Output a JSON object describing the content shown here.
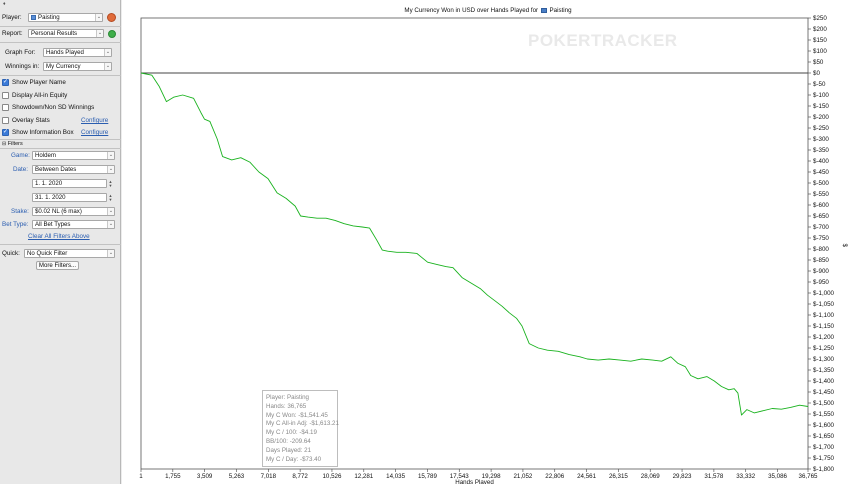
{
  "sidebar": {
    "top_mark": "♦",
    "player_label": "Player:",
    "player_value": "Paisting",
    "report_label": "Report:",
    "report_value": "Personal Results",
    "graph_for_label": "Graph For:",
    "graph_for_value": "Hands Played",
    "winnings_in_label": "Winnings in:",
    "winnings_in_value": "My Currency",
    "options": [
      {
        "label": "Show Player Name",
        "checked": true
      },
      {
        "label": "Display All-in Equity",
        "checked": false
      },
      {
        "label": "Showdown/Non SD Winnings",
        "checked": false
      },
      {
        "label": "Overlay Stats",
        "checked": false,
        "link": "Configure"
      },
      {
        "label": "Show Information Box",
        "checked": true,
        "link": "Configure"
      }
    ],
    "filters_header": "Filters",
    "game_label": "Game:",
    "game_value": "Holdem",
    "date_label": "Date:",
    "date_value": "Between Dates",
    "date_from": "1.  1. 2020",
    "date_to": "31.  1. 2020",
    "stake_label": "Stake:",
    "stake_value": "$0.02 NL (6 max)",
    "bet_type_label": "Bet Type:",
    "bet_type_value": "All Bet Types",
    "clear_filters": "Clear All Filters Above",
    "quick_label": "Quick:",
    "quick_value": "No Quick Filter",
    "more_filters": "More Filters..."
  },
  "chart_data": {
    "type": "line",
    "title": "My Currency Won in USD over Hands Played for",
    "title_player": "Paisting",
    "watermark": "POKERTRACKER",
    "xlabel": "Hands Played",
    "ylabel": "$",
    "xlim": [
      1,
      36765
    ],
    "ylim": [
      -1800,
      250
    ],
    "x_ticks": [
      1,
      1755,
      3509,
      5263,
      7018,
      8772,
      10526,
      12281,
      14035,
      15789,
      17543,
      19298,
      21052,
      22806,
      24561,
      26315,
      28069,
      29823,
      31578,
      33332,
      35086,
      36765
    ],
    "x_tick_labels": [
      "1",
      "1,755",
      "3,509",
      "5,263",
      "7,018",
      "8,772",
      "10,526",
      "12,281",
      "14,035",
      "15,789",
      "17,543",
      "19,298",
      "21,052",
      "22,806",
      "24,561",
      "26,315",
      "28,069",
      "29,823",
      "31,578",
      "33,332",
      "35,086",
      "36,765"
    ],
    "y_ticks": [
      250,
      200,
      150,
      100,
      50,
      0,
      -50,
      -100,
      -150,
      -200,
      -250,
      -300,
      -350,
      -400,
      -450,
      -500,
      -550,
      -600,
      -650,
      -700,
      -750,
      -800,
      -850,
      -900,
      -950,
      -1000,
      -1050,
      -1100,
      -1150,
      -1200,
      -1250,
      -1300,
      -1350,
      -1400,
      -1450,
      -1500,
      -1550,
      -1600,
      -1650,
      -1700,
      -1750,
      -1800
    ],
    "y_tick_labels": [
      "$250",
      "$200",
      "$150",
      "$100",
      "$50",
      "$0",
      "$-50",
      "$-100",
      "$-150",
      "$-200",
      "$-250",
      "$-300",
      "$-350",
      "$-400",
      "$-450",
      "$-500",
      "$-550",
      "$-600",
      "$-650",
      "$-700",
      "$-750",
      "$-800",
      "$-850",
      "$-900",
      "$-950",
      "$-1,000",
      "$-1,050",
      "$-1,100",
      "$-1,150",
      "$-1,200",
      "$-1,250",
      "$-1,300",
      "$-1,350",
      "$-1,400",
      "$-1,450",
      "$-1,500",
      "$-1,550",
      "$-1,600",
      "$-1,650",
      "$-1,700",
      "$-1,750",
      "$-1,800"
    ],
    "series": [
      {
        "color": "#19b21e",
        "x": [
          1,
          600,
          1000,
          1400,
          1800,
          2300,
          2900,
          3300,
          3500,
          3800,
          4200,
          4500,
          5000,
          5500,
          6000,
          6500,
          7000,
          7500,
          8000,
          8500,
          8800,
          9200,
          9700,
          10200,
          10700,
          11200,
          11700,
          12200,
          12600,
          13000,
          13300,
          13600,
          14100,
          14600,
          15200,
          15800,
          16300,
          16800,
          17200,
          17700,
          18200,
          18700,
          19100,
          19500,
          19900,
          20300,
          20700,
          21000,
          21400,
          21900,
          22400,
          23000,
          23600,
          24200,
          24600,
          25200,
          25800,
          26400,
          27000,
          27600,
          28200,
          28700,
          29200,
          29600,
          30000,
          30300,
          30700,
          31200,
          31600,
          32000,
          32400,
          32700,
          32900,
          33100,
          33400,
          33800,
          34300,
          34800,
          35300,
          35800,
          36300,
          36765
        ],
        "y": [
          0,
          -10,
          -60,
          -130,
          -110,
          -100,
          -115,
          -180,
          -210,
          -220,
          -300,
          -380,
          -395,
          -385,
          -405,
          -450,
          -480,
          -545,
          -570,
          -605,
          -650,
          -655,
          -660,
          -660,
          -670,
          -685,
          -695,
          -700,
          -705,
          -760,
          -805,
          -810,
          -815,
          -815,
          -820,
          -860,
          -870,
          -880,
          -885,
          -930,
          -955,
          -980,
          -1010,
          -1035,
          -1060,
          -1090,
          -1115,
          -1150,
          -1230,
          -1250,
          -1260,
          -1265,
          -1280,
          -1290,
          -1300,
          -1305,
          -1300,
          -1305,
          -1310,
          -1300,
          -1305,
          -1310,
          -1290,
          -1320,
          -1335,
          -1375,
          -1390,
          -1380,
          -1400,
          -1425,
          -1440,
          -1435,
          -1455,
          -1555,
          -1530,
          -1545,
          -1535,
          -1525,
          -1528,
          -1520,
          -1510,
          -1516
        ]
      }
    ]
  },
  "info_box": {
    "lines": [
      "Player: Paisting",
      "Hands: 36,765",
      "My C Won: -$1,541.45",
      "My C All-in Adj: -$1,613.21",
      "My C / 100: -$4.19",
      "BB/100: -209.64",
      "Days Played: 21",
      "My C / Day: -$73.40"
    ]
  }
}
